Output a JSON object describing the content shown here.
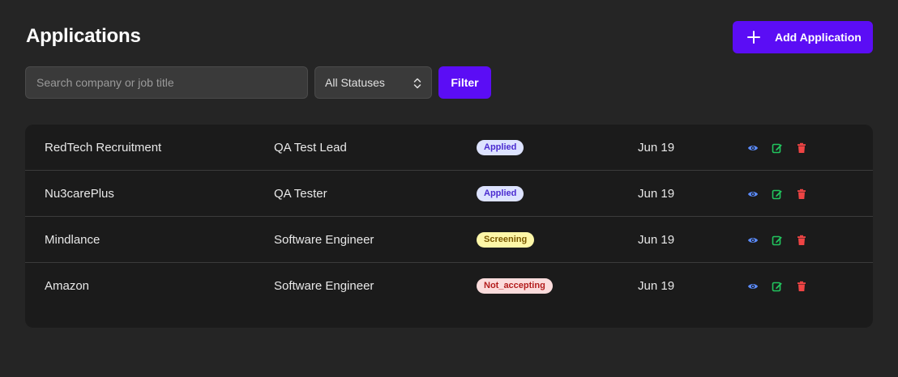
{
  "header": {
    "title": "Applications",
    "add_button_label": "Add Application"
  },
  "filters": {
    "search_placeholder": "Search company or job title",
    "search_value": "",
    "status_selected": "All Statuses",
    "filter_button_label": "Filter"
  },
  "colors": {
    "accent": "#5b0df5",
    "view_icon": "#5b8cff",
    "edit_icon": "#22c55e",
    "delete_icon": "#ef4444"
  },
  "applications": [
    {
      "company": "RedTech Recruitment",
      "job_title": "QA Test Lead",
      "status": "Applied",
      "status_key": "applied",
      "date": "Jun 19"
    },
    {
      "company": "Nu3carePlus",
      "job_title": "QA Tester",
      "status": "Applied",
      "status_key": "applied",
      "date": "Jun 19"
    },
    {
      "company": "Mindlance",
      "job_title": "Software Engineer",
      "status": "Screening",
      "status_key": "screening",
      "date": "Jun 19"
    },
    {
      "company": "Amazon",
      "job_title": "Software Engineer",
      "status": "Not_accepting",
      "status_key": "not-accepting",
      "date": "Jun 19"
    }
  ],
  "row_actions": [
    "eye-icon",
    "edit-icon",
    "trash-icon"
  ]
}
